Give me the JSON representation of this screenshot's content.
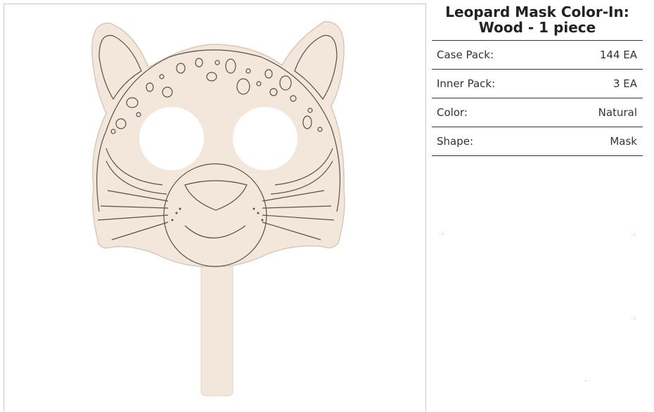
{
  "product": {
    "title_line1": "Leopard Mask Color-In:",
    "title_line2": "Wood - 1 piece",
    "image_alt": "Leopard mask wooden color-in craft"
  },
  "specs": [
    {
      "label": "Case Pack:",
      "value": "144 EA"
    },
    {
      "label": "Inner Pack:",
      "value": "3 EA"
    },
    {
      "label": "Color:",
      "value": "Natural"
    },
    {
      "label": "Shape:",
      "value": "Mask"
    }
  ],
  "colors": {
    "wood": "#f3e7dc",
    "outline": "#5a4f49",
    "border": "#333333"
  }
}
